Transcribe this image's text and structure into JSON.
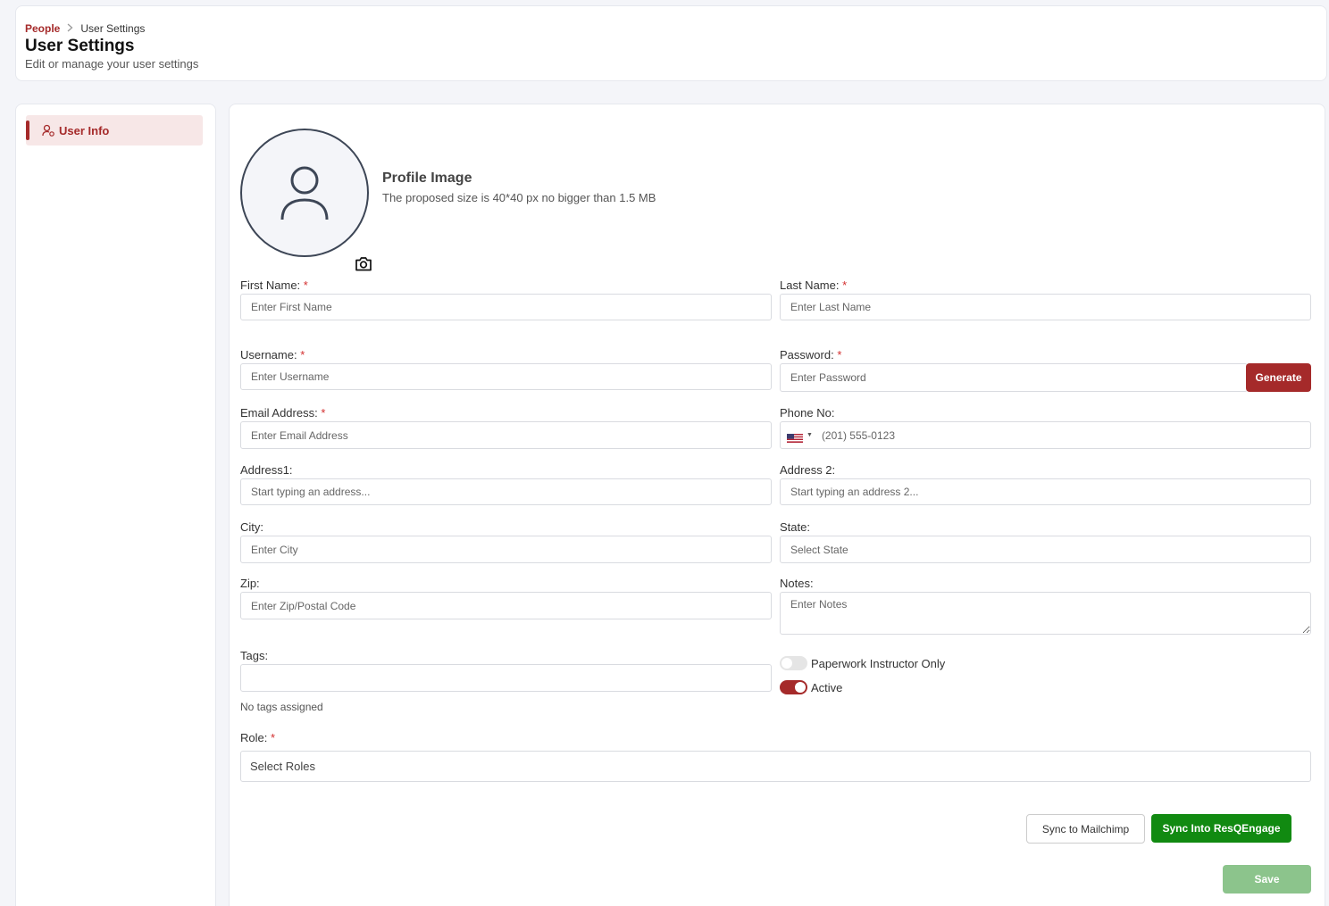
{
  "breadcrumb": {
    "parent": "People",
    "current": "User Settings"
  },
  "page": {
    "title": "User Settings",
    "subtitle": "Edit or manage your user settings"
  },
  "sidebar": {
    "items": [
      {
        "label": "User Info",
        "icon": "user-gear-icon",
        "active": true
      }
    ]
  },
  "profile": {
    "title": "Profile Image",
    "description": "The proposed size is 40*40 px no bigger than 1.5 MB"
  },
  "form": {
    "first_name": {
      "label": "First Name:",
      "required": "*",
      "placeholder": "Enter First Name"
    },
    "last_name": {
      "label": "Last Name:",
      "required": "*",
      "placeholder": "Enter Last Name"
    },
    "username": {
      "label": "Username:",
      "required": "*",
      "placeholder": "Enter Username"
    },
    "password": {
      "label": "Password:",
      "required": "*",
      "placeholder": "Enter Password",
      "generate_label": "Generate"
    },
    "email": {
      "label": "Email Address:",
      "required": "*",
      "placeholder": "Enter Email Address"
    },
    "phone": {
      "label": "Phone No:",
      "placeholder": "(201) 555-0123"
    },
    "address1": {
      "label": "Address1:",
      "placeholder": "Start typing an address..."
    },
    "address2": {
      "label": "Address 2:",
      "placeholder": "Start typing an address 2..."
    },
    "city": {
      "label": "City:",
      "placeholder": "Enter City"
    },
    "state": {
      "label": "State:",
      "placeholder": "Select State"
    },
    "zip": {
      "label": "Zip:",
      "placeholder": "Enter Zip/Postal Code"
    },
    "notes": {
      "label": "Notes:",
      "placeholder": "Enter Notes"
    },
    "tags": {
      "label": "Tags:",
      "empty_text": "No tags assigned"
    },
    "paperwork_toggle": {
      "label": "Paperwork Instructor Only",
      "checked": false
    },
    "active_toggle": {
      "label": "Active",
      "checked": true
    },
    "role": {
      "label": "Role:",
      "required": "*",
      "placeholder": "Select Roles"
    }
  },
  "actions": {
    "mailchimp": "Sync to Mailchimp",
    "resq": "Sync Into ResQEngage",
    "save": "Save"
  },
  "colors": {
    "accent": "#a52a2a",
    "green": "#118a11",
    "save_disabled": "#8cc48c"
  }
}
